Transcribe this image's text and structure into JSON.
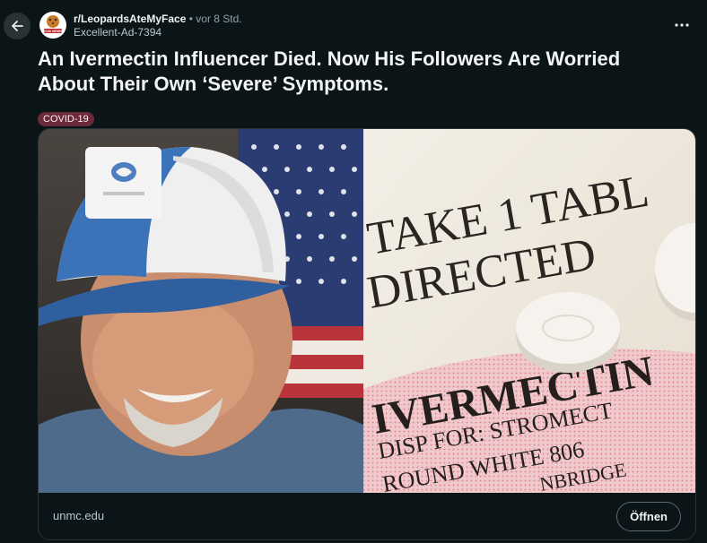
{
  "post": {
    "subreddit": "r/LeopardsAteMyFace",
    "separator": "•",
    "time": "vor 8 Std.",
    "author": "Excellent-Ad-7394",
    "title": "An Ivermectin Influencer Died. Now His Followers Are Worried About Their Own ‘Severe’ Symptoms.",
    "flair": "COVID-19"
  },
  "avatar": {
    "label": "PROUD MEMBER"
  },
  "link": {
    "domain": "unmc.edu",
    "open_label": "Öffnen"
  },
  "image": {
    "label_line1": "TAKE 1 TABL",
    "label_line2": "DIRECTED",
    "drug": "IVERMECTIN",
    "disp": "DISP FOR: STROMECT",
    "desc": "ROUND WHITE 806",
    "maker": "NBRIDGE"
  },
  "colors": {
    "background": "#0b1416",
    "flair": "#6b2a3a",
    "card_border": "#2a3236"
  }
}
